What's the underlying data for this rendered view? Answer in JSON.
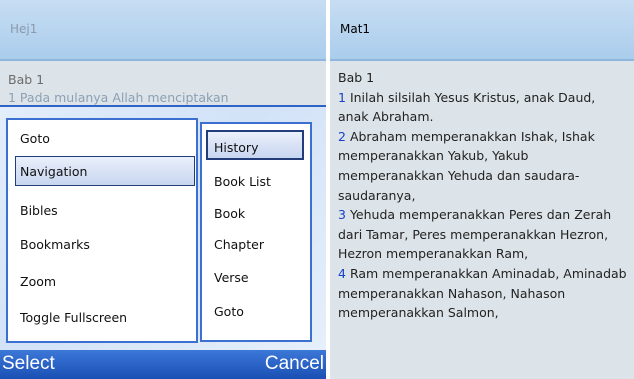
{
  "left_screen": {
    "header_title": "Hej1",
    "chapter": "Bab 1",
    "verse_preview": "1  Pada mulanya Allah menciptakan",
    "menu": {
      "items": [
        "Goto",
        "Navigation",
        "Bibles",
        "Bookmarks",
        "Zoom",
        "Toggle Fullscreen"
      ],
      "selected": "Navigation"
    },
    "submenu": {
      "items": [
        "History",
        "Book List",
        "Book",
        "Chapter",
        "Verse",
        "Goto"
      ],
      "selected": "History"
    },
    "softkeys": {
      "left": "Select",
      "right": "Cancel"
    }
  },
  "right_screen": {
    "header_title": "Mat1",
    "chapter": "Bab 1",
    "verses": [
      {
        "num": "1",
        "text": "Inilah silsilah Yesus Kristus, anak Daud, anak Abraham."
      },
      {
        "num": "2",
        "text": "Abraham memperanakkan Ishak, Ishak memperanakkan Yakub, Yakub memperanakkan Yehuda dan saudara-saudaranya,"
      },
      {
        "num": "3",
        "text": "Yehuda memperanakkan Peres dan Zerah dari Tamar, Peres memperanakkan Hezron, Hezron memperanakkan Ram,"
      },
      {
        "num": "4",
        "text": "Ram memperanakkan Aminadab, Aminadab memperanakkan Nahason, Nahason memperanakkan Salmon,"
      }
    ]
  },
  "colors": {
    "header_bg": "#aacdec",
    "verse_number": "#1840c8",
    "softkey_bar": "#2a5fc6",
    "menu_border": "#3b6fd0"
  }
}
